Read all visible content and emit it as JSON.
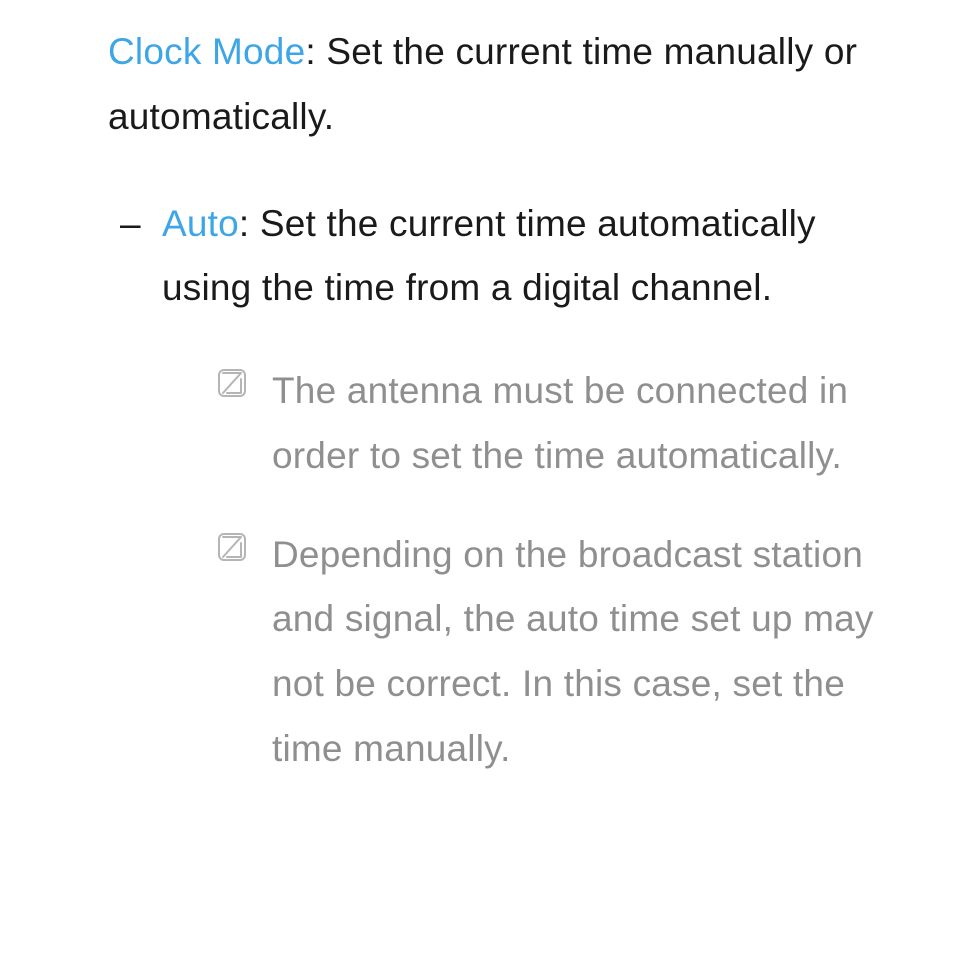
{
  "clockMode": {
    "term": "Clock Mode",
    "desc": ": Set the current time manually or automatically."
  },
  "auto": {
    "dash": "–",
    "term": "Auto",
    "desc": ": Set the current time automatically using the time from a digital channel."
  },
  "notes": [
    "The antenna must be connected in order to set the time automatically.",
    "Depending on the broadcast station and signal, the auto time set up may not be correct. In this case, set the time manually."
  ]
}
